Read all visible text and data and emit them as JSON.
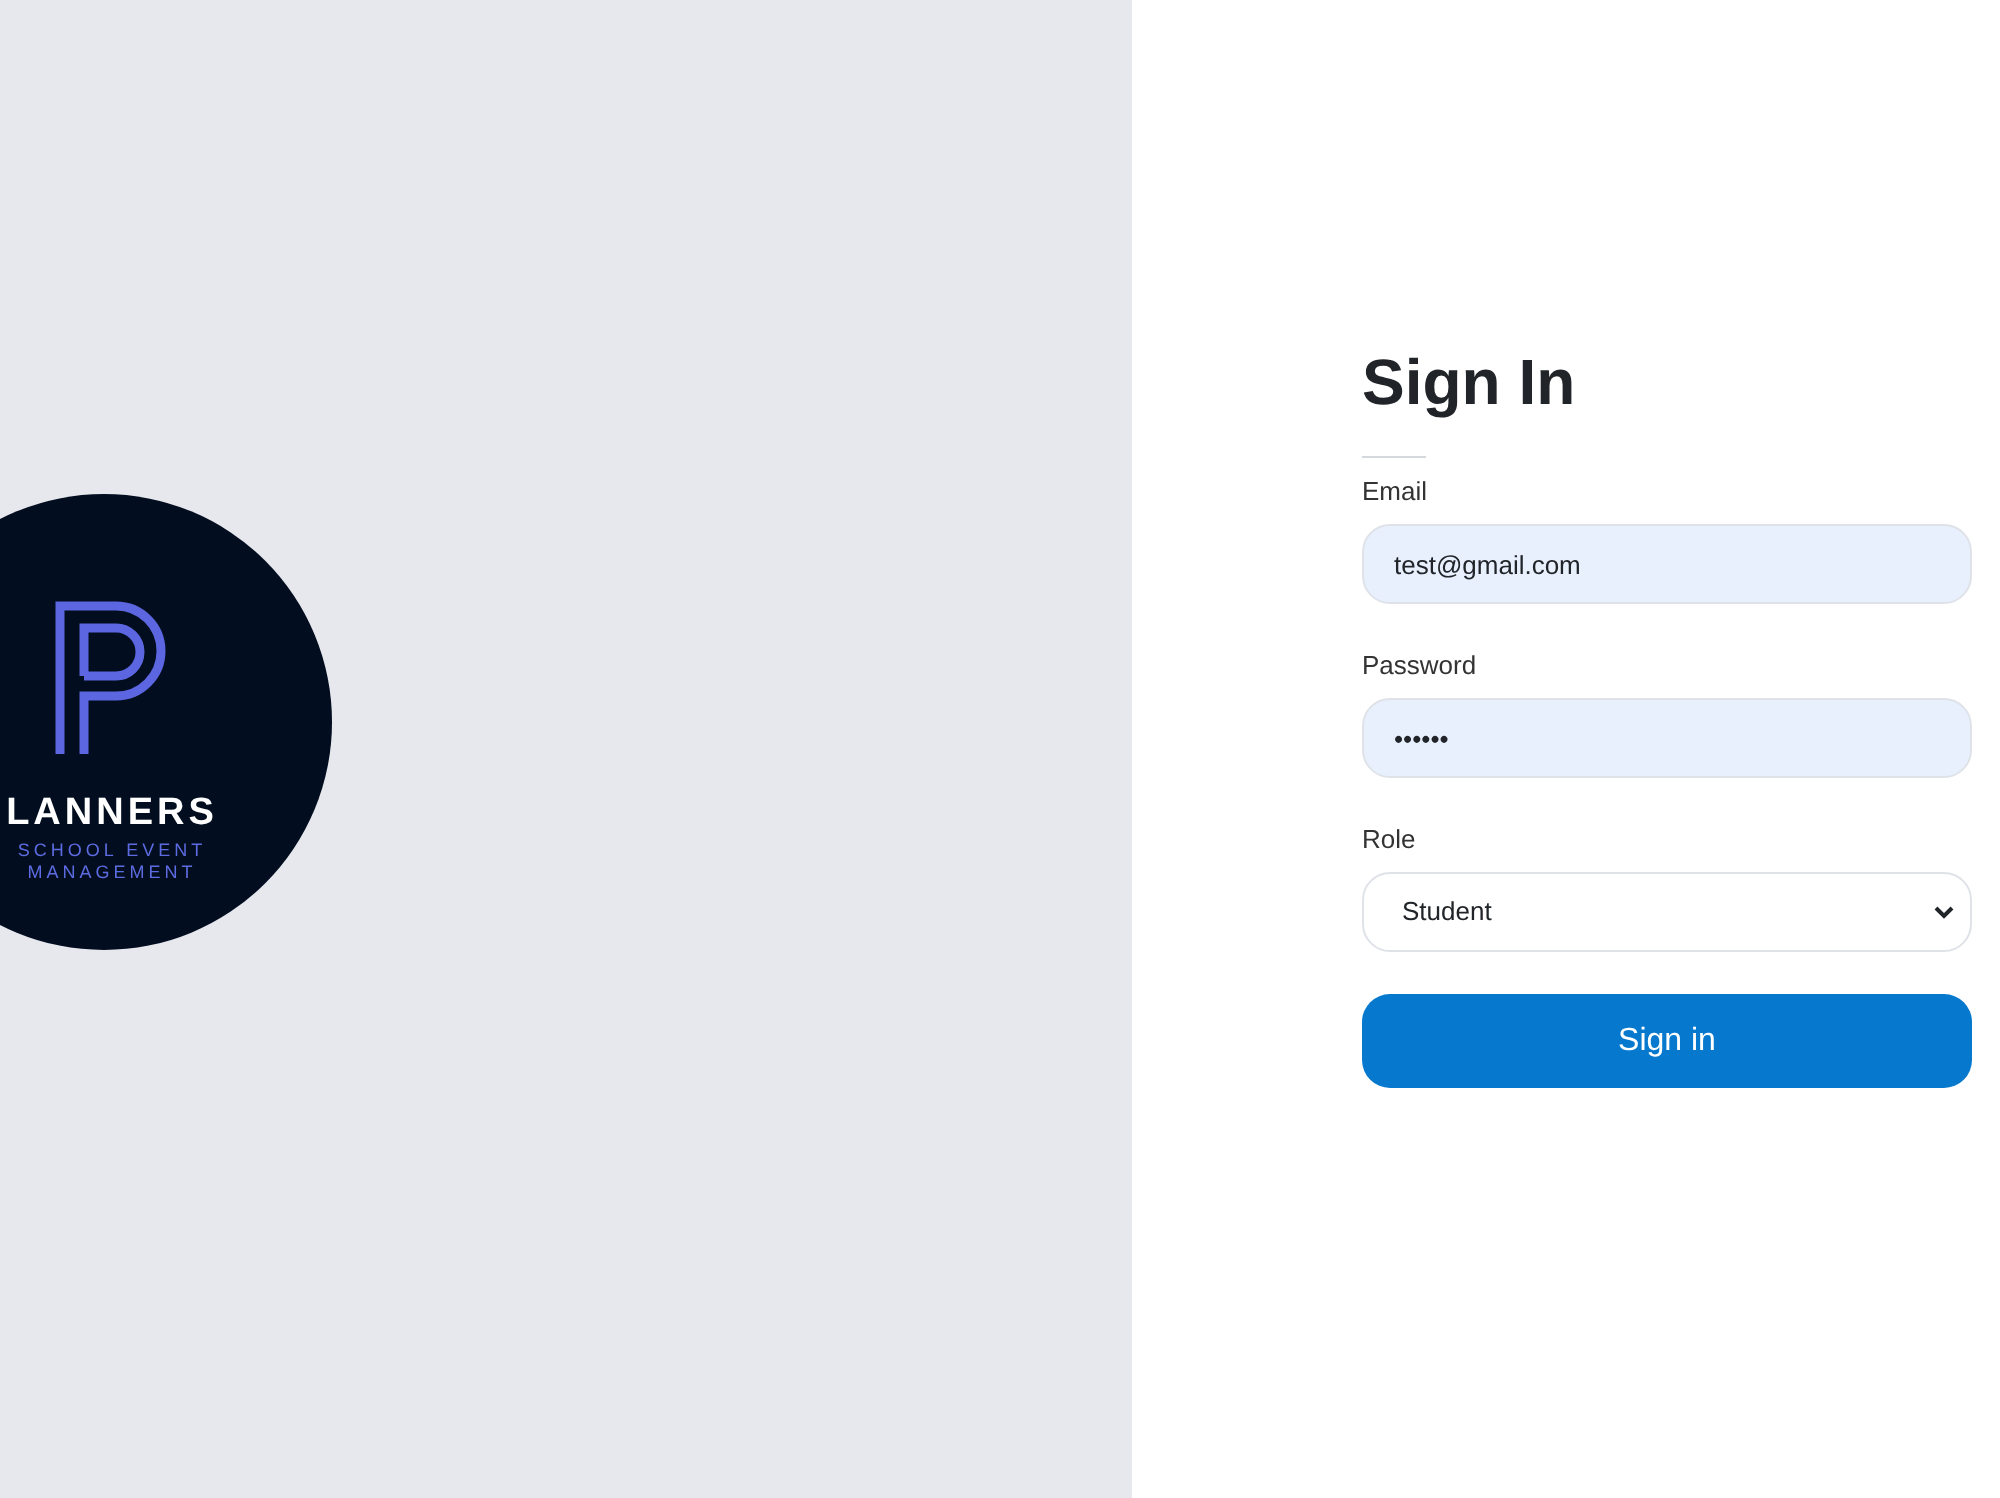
{
  "logo": {
    "wordmark": "LANNERS",
    "tagline": [
      "SCHOOL EVENT",
      "MANAGEMENT"
    ]
  },
  "form": {
    "title": "Sign In",
    "fields": [
      {
        "kind": "text",
        "label": "Email",
        "value": "test@gmail.com",
        "autofilled": true
      },
      {
        "kind": "text",
        "label": "Password",
        "value": "••••••",
        "autofilled": true
      },
      {
        "kind": "select",
        "label": "Role",
        "value": "Student",
        "autofilled": false
      }
    ],
    "submit": "Sign in"
  }
}
